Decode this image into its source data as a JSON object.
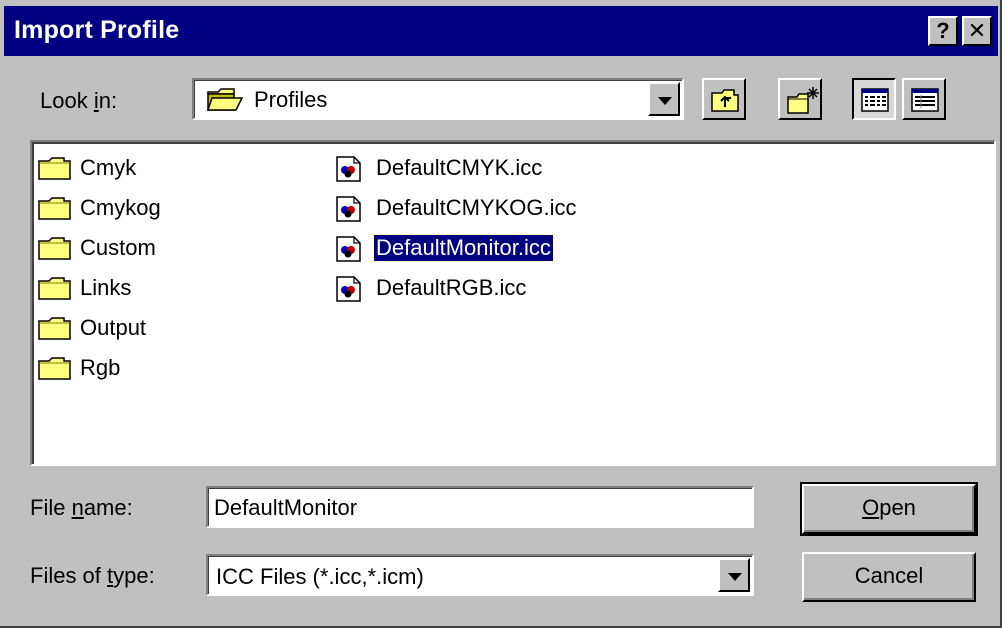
{
  "window": {
    "title": "Import Profile",
    "help_label": "?",
    "close_label": "✕"
  },
  "lookin": {
    "label_pre": "Look ",
    "label_ul": "i",
    "label_post": "n:",
    "value": "Profiles"
  },
  "toolbar": {
    "icons": [
      "up-one-level-icon",
      "create-new-folder-icon",
      "list-view-icon",
      "details-view-icon"
    ]
  },
  "folders": [
    {
      "label": "Cmyk"
    },
    {
      "label": "Cmykog"
    },
    {
      "label": "Custom"
    },
    {
      "label": "Links"
    },
    {
      "label": "Output"
    },
    {
      "label": "Rgb"
    }
  ],
  "files": [
    {
      "label": "DefaultCMYK.icc",
      "selected": false
    },
    {
      "label": "DefaultCMYKOG.icc",
      "selected": false
    },
    {
      "label": "DefaultMonitor.icc",
      "selected": true
    },
    {
      "label": "DefaultRGB.icc",
      "selected": false
    }
  ],
  "filename": {
    "label_pre": "File ",
    "label_ul": "n",
    "label_post": "ame:",
    "value": "DefaultMonitor"
  },
  "filetype": {
    "label_pre": "Files of ",
    "label_ul": "t",
    "label_post": "ype:",
    "value": "ICC Files (*.icc,*.icm)"
  },
  "buttons": {
    "open_ul": "O",
    "open_rest": "pen",
    "cancel": "Cancel"
  },
  "colors": {
    "titlebar": "#000080",
    "face": "#c0c0c0",
    "selection": "#000080",
    "folder": "#ffff80"
  }
}
